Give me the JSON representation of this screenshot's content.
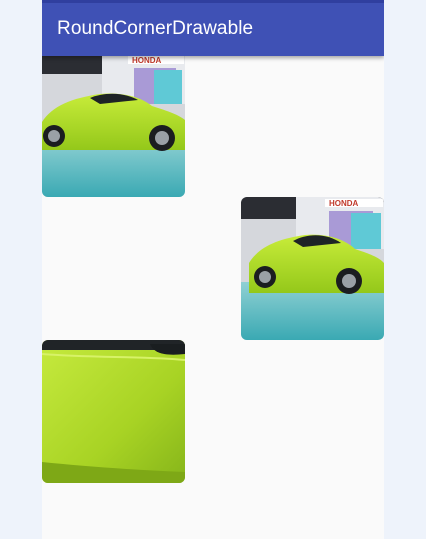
{
  "app": {
    "title": "RoundCornerDrawable"
  },
  "images": [
    {
      "name": "green-car-photo-1",
      "subject": "lime green car at auto show",
      "brand_text": "HONDA"
    },
    {
      "name": "green-car-photo-2",
      "subject": "lime green car at auto show",
      "brand_text": "HONDA"
    },
    {
      "name": "green-car-photo-closeup",
      "subject": "lime green car body close-up"
    }
  ],
  "colors": {
    "appbar": "#3f51b5",
    "statusbar": "#303f9f",
    "background": "#fafafa",
    "outer": "#eef3fb",
    "car_green": "#b5e02b"
  }
}
